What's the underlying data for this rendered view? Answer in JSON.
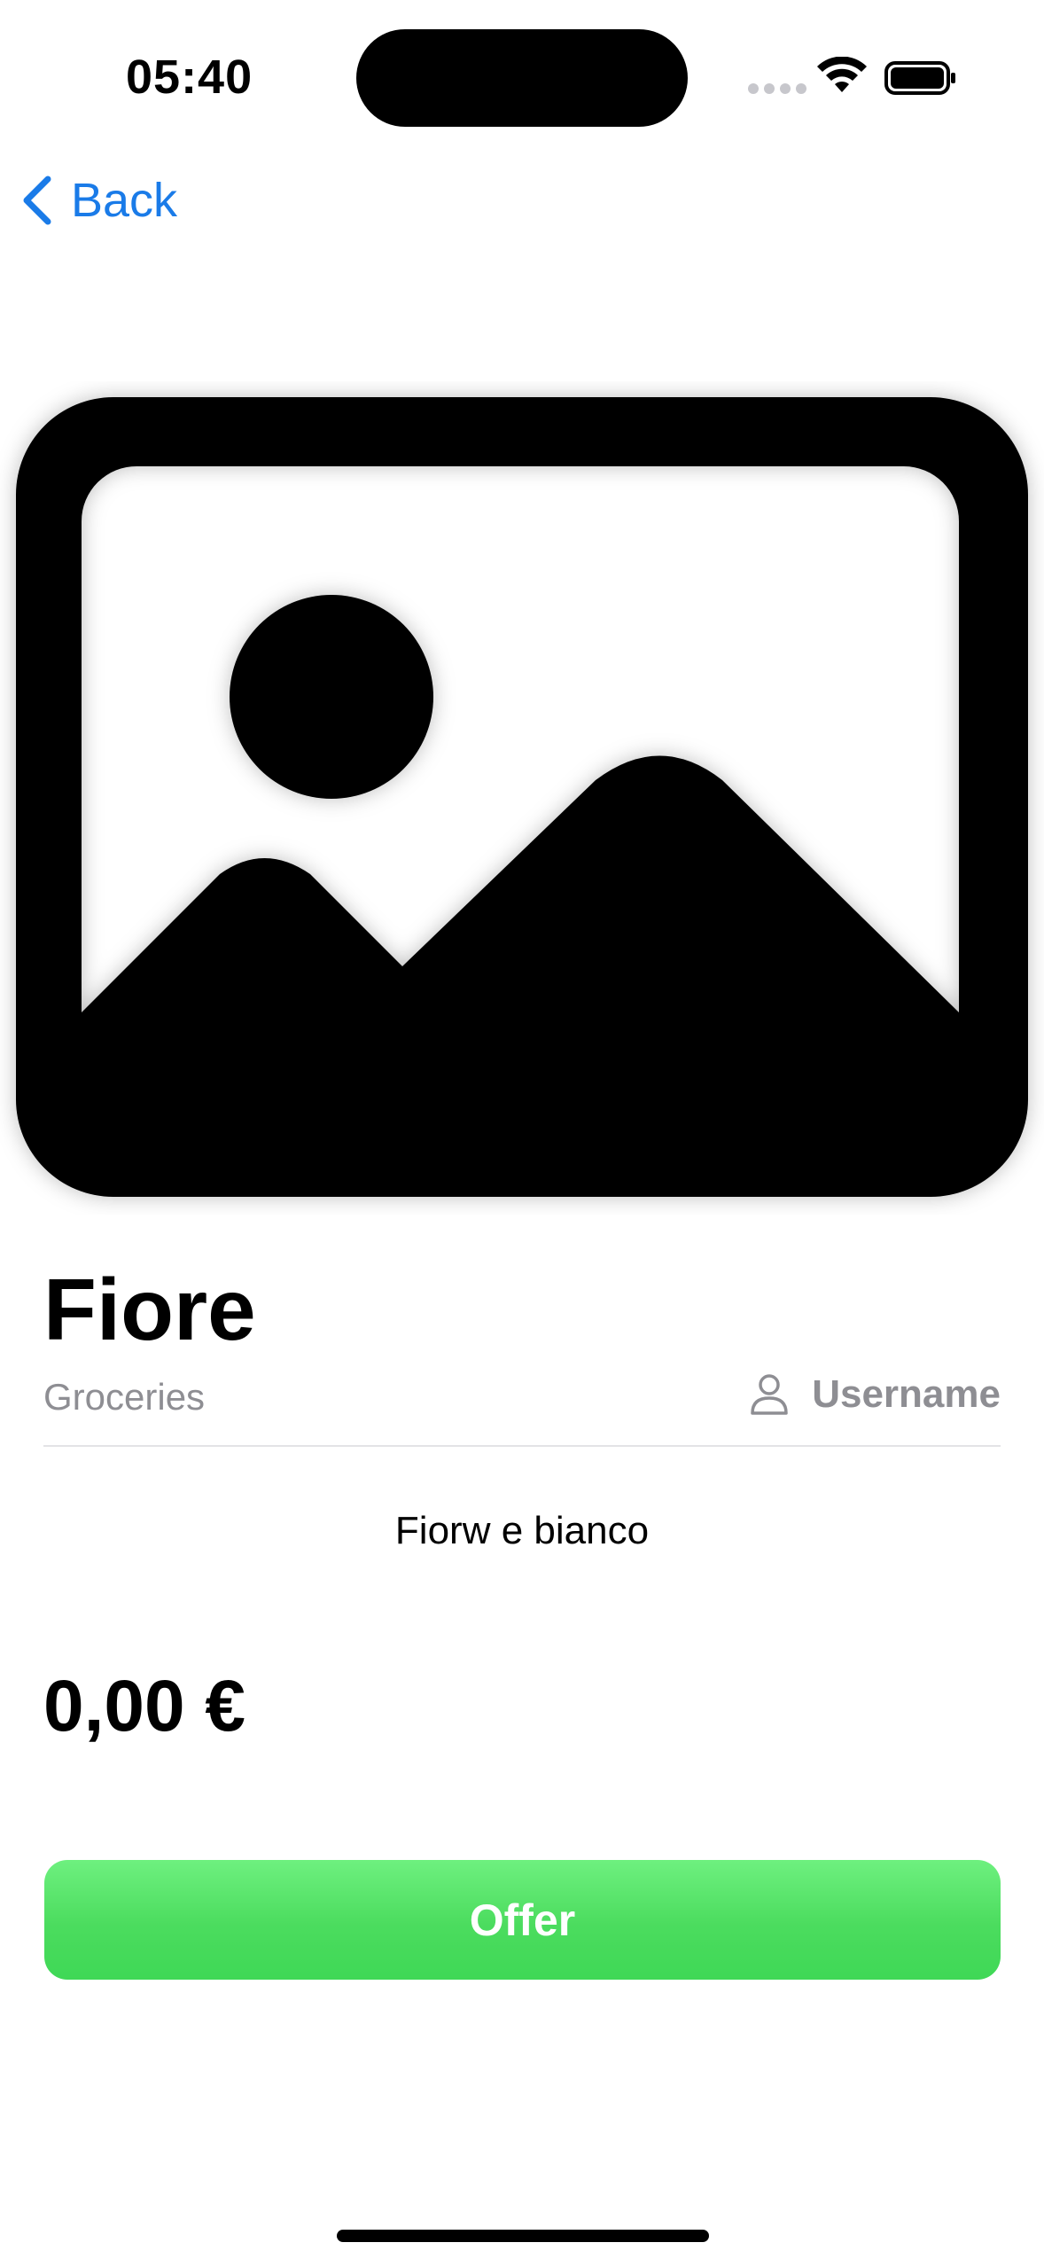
{
  "status_bar": {
    "time": "05:40",
    "icons": [
      "cellular-signal-icon",
      "wifi-icon",
      "battery-icon"
    ]
  },
  "nav": {
    "back_label": "Back",
    "back_icon": "chevron-left-icon"
  },
  "product": {
    "image_icon": "photo-placeholder-icon",
    "title": "Fiore",
    "category": "Groceries",
    "seller_icon": "person-icon",
    "seller": "Username",
    "description": "Fiorw e bianco",
    "price": "0,00 €"
  },
  "actions": {
    "offer_label": "Offer"
  },
  "colors": {
    "accent": "#1a7be8",
    "offer_button": "#4bdc5e",
    "secondary_text": "#8e8e93"
  }
}
